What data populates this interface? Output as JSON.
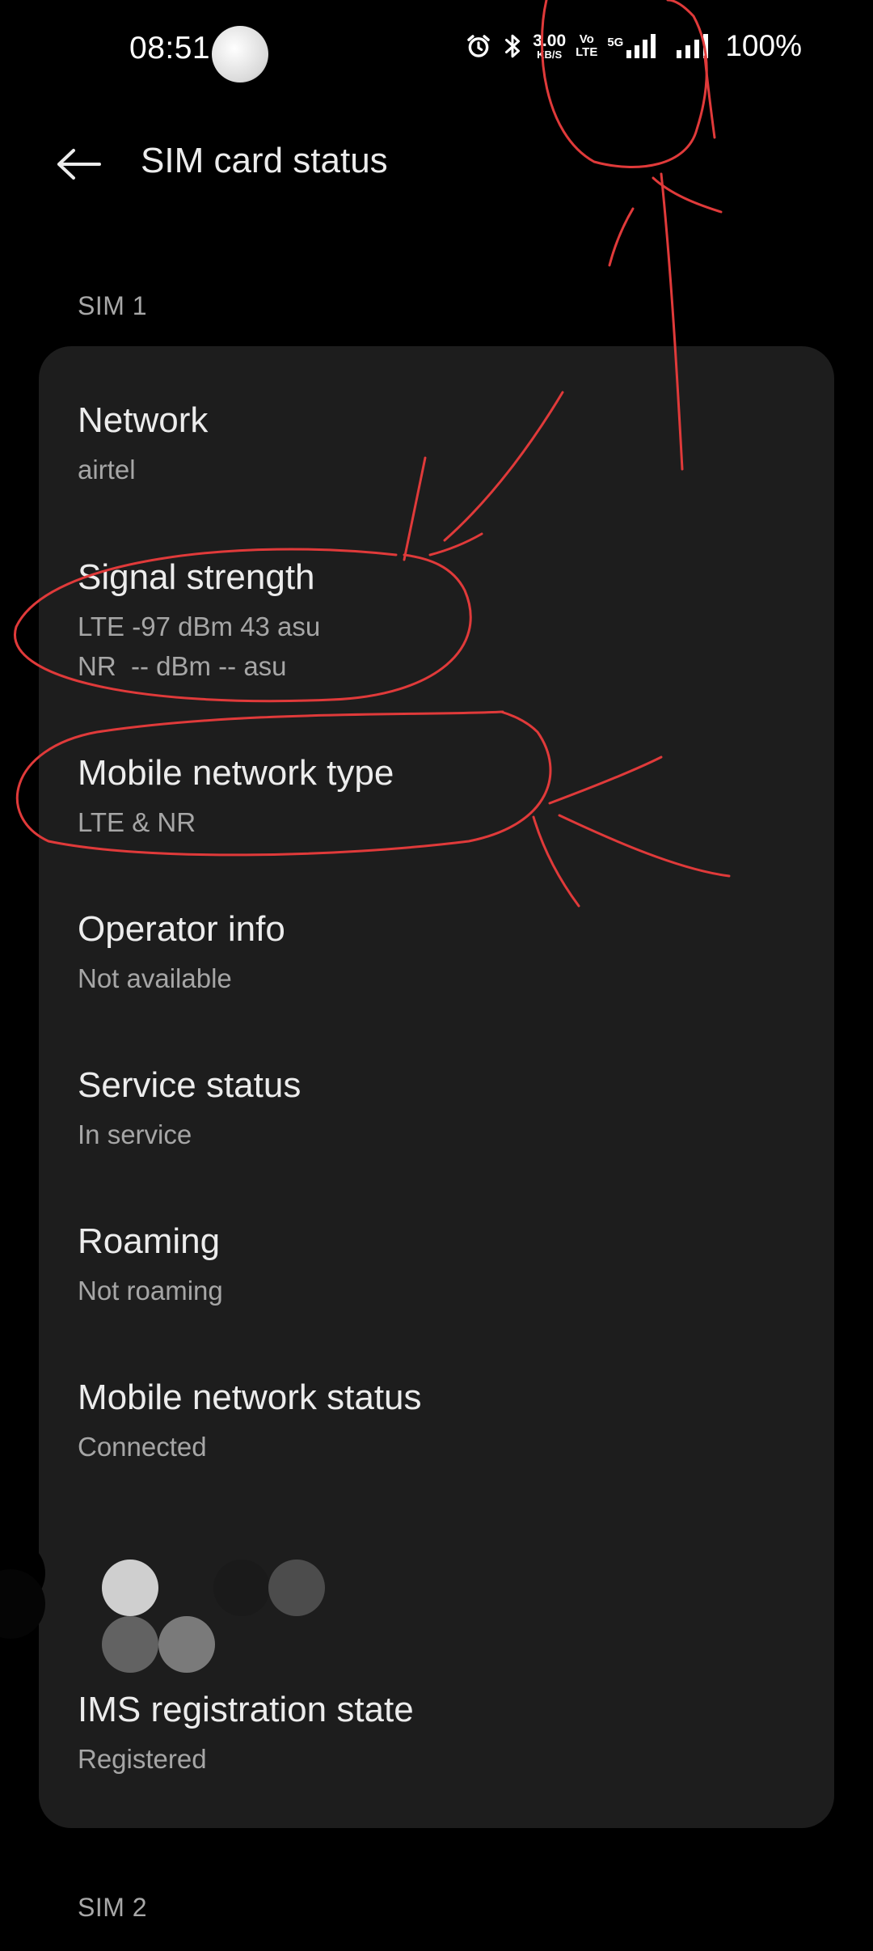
{
  "status_bar": {
    "time": "08:51",
    "net_speed_value": "3.00",
    "net_speed_unit": "KB/S",
    "volte_top": "Vo",
    "volte_bottom": "LTE",
    "network_gen": "5G",
    "battery_percent": "100%",
    "icons": [
      "alarm-icon",
      "bluetooth-icon",
      "signal-icon",
      "signal-icon"
    ]
  },
  "header": {
    "title": "SIM card status",
    "back_icon": "arrow-left-icon"
  },
  "sections": {
    "sim1_label": "SIM 1",
    "sim2_label": "SIM 2"
  },
  "items": [
    {
      "title": "Network",
      "value": "airtel"
    },
    {
      "title": "Signal strength",
      "value": "LTE -97 dBm 43 asu\nNR  -- dBm -- asu"
    },
    {
      "title": "Mobile network type",
      "value": "LTE & NR"
    },
    {
      "title": "Operator info",
      "value": "Not available"
    },
    {
      "title": "Service status",
      "value": "In service"
    },
    {
      "title": "Roaming",
      "value": "Not roaming"
    },
    {
      "title": "Mobile network status",
      "value": "Connected"
    },
    {
      "title": "IMS registration state",
      "value": "Registered"
    }
  ],
  "colors": {
    "background": "#000000",
    "card": "#1d1d1d",
    "title_text": "#ececec",
    "value_text": "#a6a6a6",
    "annotation": "#e03a3a"
  }
}
